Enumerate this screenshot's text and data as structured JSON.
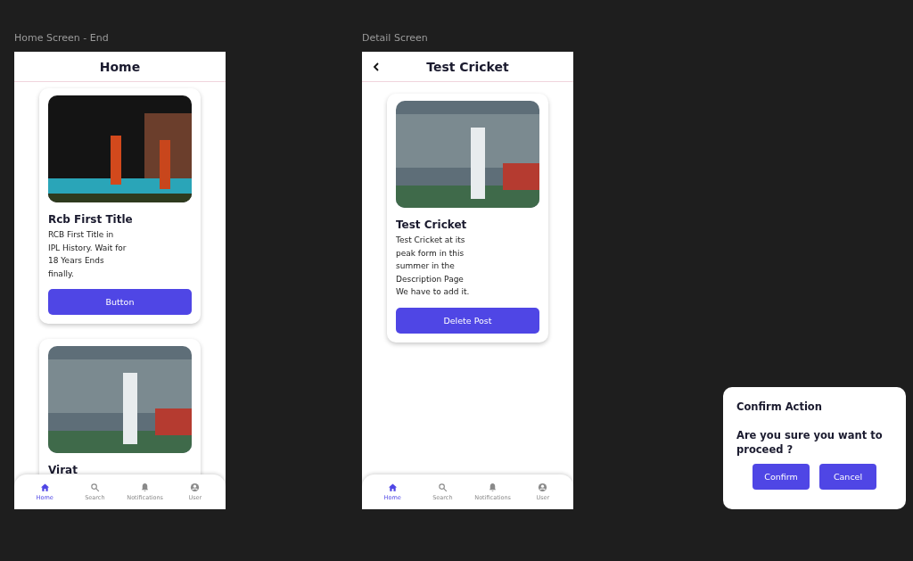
{
  "frames": [
    {
      "kind": "home",
      "label": "Home Screen - End",
      "header": {
        "title": "Home"
      },
      "cards": [
        {
          "title": "Rcb First Title",
          "description": "RCB First Title in IPL History. Wait for 18 Years Ends finally.",
          "button": "Button"
        },
        {
          "title": "Virat"
        }
      ],
      "nav": [
        {
          "label": "Home",
          "selected": true
        },
        {
          "label": "Search",
          "selected": false
        },
        {
          "label": "Notifications",
          "selected": false
        },
        {
          "label": "User",
          "selected": false
        }
      ]
    },
    {
      "kind": "detail",
      "label": "Detail Screen",
      "header": {
        "title": "Test Cricket"
      },
      "cards": [
        {
          "title": "Test Cricket",
          "description": "Test Cricket at its peak form in this summer in the Description Page We have to add it.",
          "button": "Delete Post"
        }
      ],
      "nav": [
        {
          "label": "Home",
          "selected": true
        },
        {
          "label": "Search",
          "selected": false
        },
        {
          "label": "Notifications",
          "selected": false
        },
        {
          "label": "User",
          "selected": false
        }
      ]
    }
  ],
  "dialog": {
    "title": "Confirm Action",
    "message": "Are you sure you want to proceed ?",
    "buttons": [
      "Confirm",
      "Cancel"
    ]
  }
}
